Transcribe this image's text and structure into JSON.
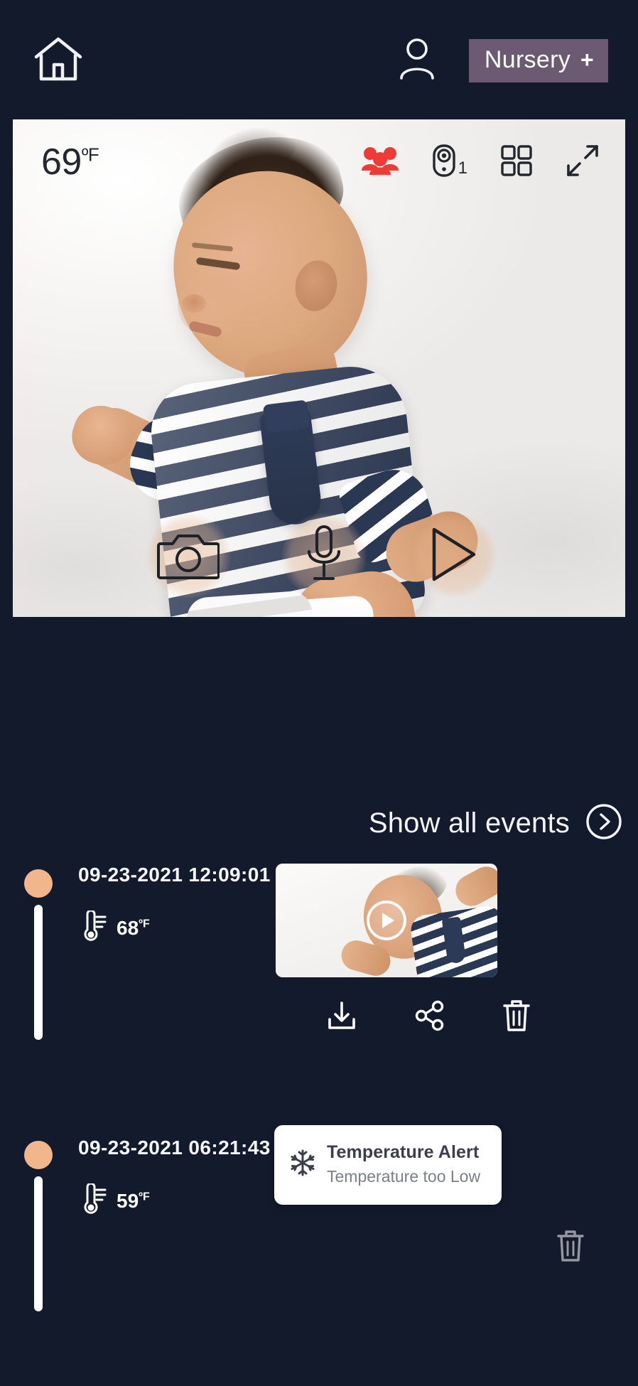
{
  "header": {
    "home_icon": "home-icon",
    "user_icon": "user-account-icon",
    "badge_label": "Nursery",
    "badge_plus": "+"
  },
  "video": {
    "temperature": "69",
    "temperature_unit": "ºF",
    "icons": {
      "presence": "people-group-icon",
      "camera": "camera-device-icon",
      "camera_count": "1",
      "grid": "grid-view-icon",
      "fullscreen": "expand-fullscreen-icon"
    },
    "controls": {
      "snapshot": "camera-shutter-icon",
      "talk": "microphone-icon",
      "play": "play-icon"
    }
  },
  "events_header": {
    "label": "Show all events",
    "chevron": "chevron-right-circle-icon"
  },
  "events": [
    {
      "timestamp": "09-23-2021 12:09:01",
      "temperature": "68",
      "temperature_unit": "ºF",
      "thermo_icon": "thermometer-icon",
      "type": "video",
      "thumbnail_play": "play-circle-icon",
      "actions": [
        {
          "name": "download-icon",
          "label": "Download"
        },
        {
          "name": "share-icon",
          "label": "Share"
        },
        {
          "name": "delete-icon",
          "label": "Delete"
        }
      ]
    },
    {
      "timestamp": "09-23-2021 06:21:43",
      "temperature": "59",
      "temperature_unit": "ºF",
      "thermo_icon": "thermometer-icon",
      "type": "alert",
      "alert": {
        "icon": "snowflake-icon",
        "title": "Temperature Alert",
        "subtitle": "Temperature too Low"
      },
      "actions": [
        {
          "name": "delete-icon",
          "label": "Delete"
        }
      ]
    }
  ],
  "colors": {
    "background": "#121a2c",
    "badge": "#6b5a72",
    "accent_dot": "#f2b68c",
    "presence_red": "#ef3b36",
    "text_light": "#f5f6f8",
    "card_white": "#ffffff"
  }
}
